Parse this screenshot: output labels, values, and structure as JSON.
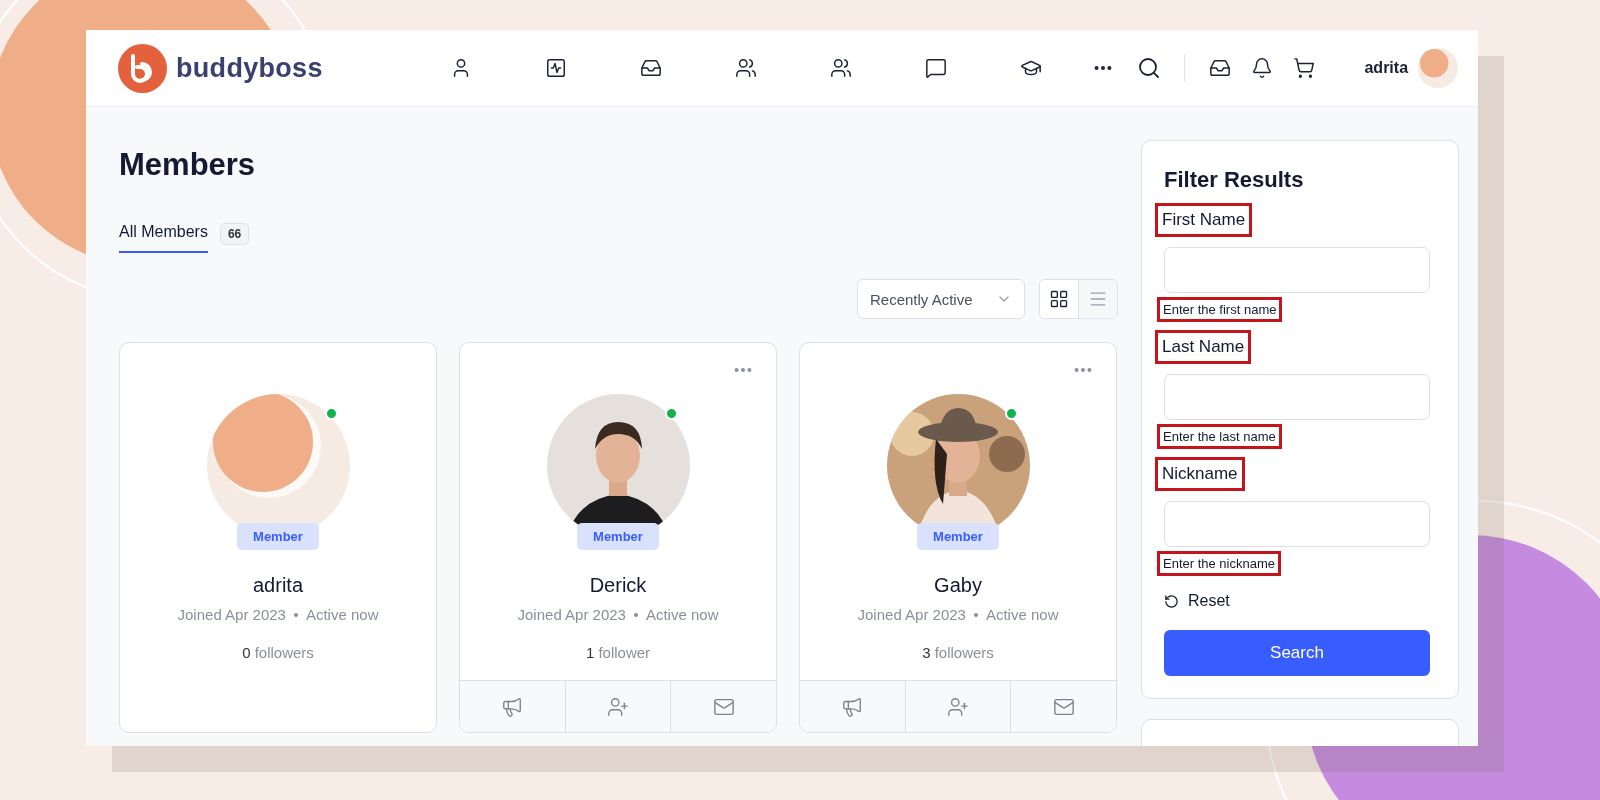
{
  "header": {
    "logo_text": "buddyboss",
    "username": "adrita"
  },
  "page": {
    "title": "Members"
  },
  "tabs": [
    {
      "label": "All Members",
      "count": "66",
      "selected": true
    }
  ],
  "sort": {
    "value": "Recently Active"
  },
  "view_toggle": [
    {
      "kind": "grid",
      "selected": true
    },
    {
      "kind": "list",
      "selected": false
    }
  ],
  "members": [
    {
      "name": "adrita",
      "kind": "self",
      "role": "Member",
      "joined": "Joined Apr 2023",
      "activity": "Active now",
      "followers_count": "0",
      "followers_label": "followers",
      "online": true
    },
    {
      "name": "Derick",
      "kind": "other",
      "role": "Member",
      "joined": "Joined Apr 2023",
      "activity": "Active now",
      "followers_count": "1",
      "followers_label": "follower",
      "online": true
    },
    {
      "name": "Gaby",
      "kind": "other",
      "role": "Member",
      "joined": "Joined Apr 2023",
      "activity": "Active now",
      "followers_count": "3",
      "followers_label": "followers",
      "online": true
    }
  ],
  "filter": {
    "title": "Filter Results",
    "fields": [
      {
        "label": "First Name",
        "hint": "Enter the first name"
      },
      {
        "label": "Last Name",
        "hint": "Enter the last name"
      },
      {
        "label": "Nickname",
        "hint": "Enter the nickname"
      }
    ],
    "reset": "Reset",
    "submit": "Search"
  }
}
